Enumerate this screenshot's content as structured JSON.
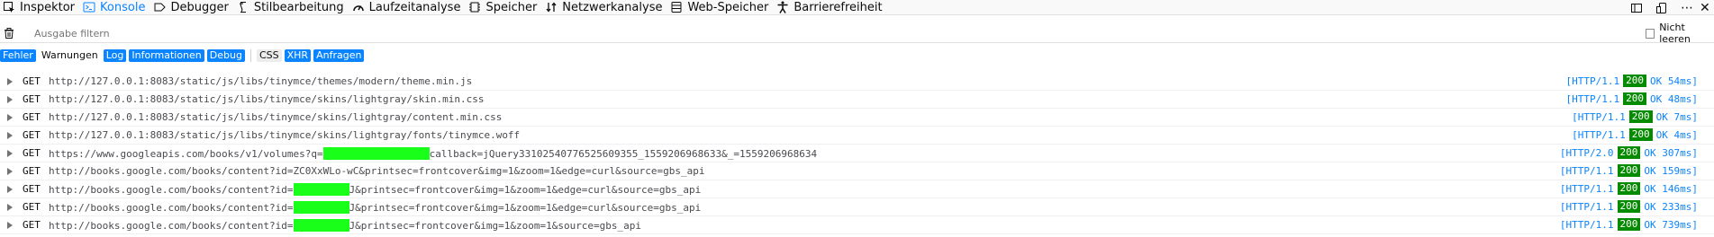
{
  "toolbar": {
    "tabs": [
      {
        "label": "Inspektor",
        "icon": "inspector-icon",
        "selected": false
      },
      {
        "label": "Konsole",
        "icon": "console-icon",
        "selected": true
      },
      {
        "label": "Debugger",
        "icon": "debugger-icon",
        "selected": false
      },
      {
        "label": "Stilbearbeitung",
        "icon": "style-editor-icon",
        "selected": false
      },
      {
        "label": "Laufzeitanalyse",
        "icon": "performance-icon",
        "selected": false
      },
      {
        "label": "Speicher",
        "icon": "memory-icon",
        "selected": false
      },
      {
        "label": "Netzwerkanalyse",
        "icon": "network-icon",
        "selected": false
      },
      {
        "label": "Web-Speicher",
        "icon": "storage-icon",
        "selected": false
      },
      {
        "label": "Barrierefreiheit",
        "icon": "accessibility-icon",
        "selected": false
      }
    ]
  },
  "filter": {
    "placeholder": "Ausgabe filtern",
    "persist_label": "Nicht leeren"
  },
  "chips": {
    "levels": [
      {
        "label": "Fehler",
        "on": true
      },
      {
        "label": "Warnungen",
        "on": false
      },
      {
        "label": "Log",
        "on": true
      },
      {
        "label": "Informationen",
        "on": true
      },
      {
        "label": "Debug",
        "on": true
      }
    ],
    "groups": [
      {
        "label": "CSS",
        "on": false
      },
      {
        "label": "XHR",
        "on": true
      },
      {
        "label": "Anfragen",
        "on": true
      }
    ]
  },
  "messages": [
    {
      "method": "GET",
      "parts": [
        "http://127.0.0.1:8083/static/js/libs/tinymce/themes/modern/theme.min.js"
      ],
      "proto": "[HTTP/1.1",
      "code": "200",
      "suffix": "OK 54ms]"
    },
    {
      "method": "GET",
      "parts": [
        "http://127.0.0.1:8083/static/js/libs/tinymce/skins/lightgray/skin.min.css"
      ],
      "proto": "[HTTP/1.1",
      "code": "200",
      "suffix": "OK 48ms]"
    },
    {
      "method": "GET",
      "parts": [
        "http://127.0.0.1:8083/static/js/libs/tinymce/skins/lightgray/content.min.css"
      ],
      "proto": "[HTTP/1.1",
      "code": "200",
      "suffix": "OK 7ms]"
    },
    {
      "method": "GET",
      "parts": [
        "http://127.0.0.1:8083/static/js/libs/tinymce/skins/lightgray/fonts/tinymce.woff"
      ],
      "proto": "[HTTP/1.1",
      "code": "200",
      "suffix": "OK 4ms]"
    },
    {
      "method": "GET",
      "parts": [
        "https://www.googleapis.com/books/v1/volumes?q=",
        "callback=jQuery33102540776525609355_1559206968633&_=1559206968634"
      ],
      "proto": "[HTTP/2.0",
      "code": "200",
      "suffix": "OK 307ms]"
    },
    {
      "method": "GET",
      "parts": [
        "http://books.google.com/books/content?id=ZC0XxWLo-wC&printsec=frontcover&img=1&zoom=1&edge=curl&source=gbs_api"
      ],
      "proto": "[HTTP/1.1",
      "code": "200",
      "suffix": "OK 159ms]"
    },
    {
      "method": "GET",
      "parts": [
        "http://books.google.com/books/content?id=",
        "J&printsec=frontcover&img=1&zoom=1&edge=curl&source=gbs_api"
      ],
      "proto": "[HTTP/1.1",
      "code": "200",
      "suffix": "OK 146ms]"
    },
    {
      "method": "GET",
      "parts": [
        "http://books.google.com/books/content?id=",
        "J&printsec=frontcover&img=1&zoom=1&edge=curl&source=gbs_api"
      ],
      "proto": "[HTTP/1.1",
      "code": "200",
      "suffix": "OK 233ms]"
    },
    {
      "method": "GET",
      "parts": [
        "http://books.google.com/books/content?id=",
        "J&printsec=frontcover&img=1&zoom=1&source=gbs_api"
      ],
      "proto": "[HTTP/1.1",
      "code": "200",
      "suffix": "OK 739ms]"
    }
  ],
  "colors": {
    "accent": "#0a84ff",
    "status_ok": "#058b00",
    "redaction": "#19ff19"
  }
}
